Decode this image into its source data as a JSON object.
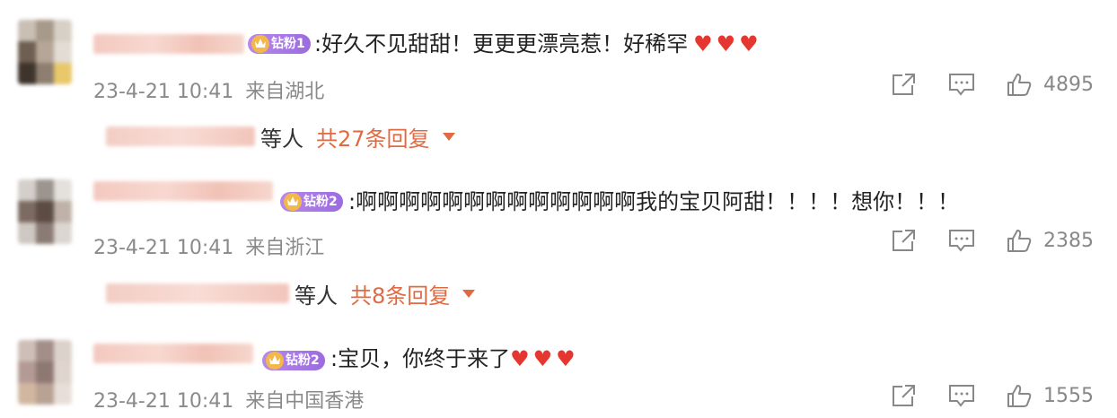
{
  "comments": [
    {
      "badge": "钻粉1",
      "text": ":好久不见甜甜！更更更漂亮惹！好稀罕",
      "hearts": "♥♥♥",
      "time": "23-4-21 10:41",
      "location": "来自湖北",
      "likes": "4895",
      "reply_suffix": "等人",
      "reply_total": "共27条回复"
    },
    {
      "badge": "钻粉2",
      "text": ":啊啊啊啊啊啊啊啊啊啊啊啊啊我的宝贝阿甜！！！！想你！！！",
      "hearts": "",
      "time": "23-4-21 10:41",
      "location": "来自浙江",
      "likes": "2385",
      "reply_suffix": "等人",
      "reply_total": "共8条回复"
    },
    {
      "badge": "钻粉2",
      "text": ":宝贝，你终于来了",
      "hearts": "♥♥♥",
      "time": "23-4-21 10:41",
      "location": "来自中国香港",
      "likes": "1555"
    }
  ],
  "icons": {
    "share": "share-icon",
    "comment": "comment-icon",
    "like": "thumbs-up-icon",
    "reply_expand": "chevron-down-icon",
    "badge": "crown-icon"
  },
  "colors": {
    "heart": "#e5362f",
    "reply_link": "#e06a42",
    "badge": "#a878e6",
    "meta": "#8a8a8a"
  }
}
